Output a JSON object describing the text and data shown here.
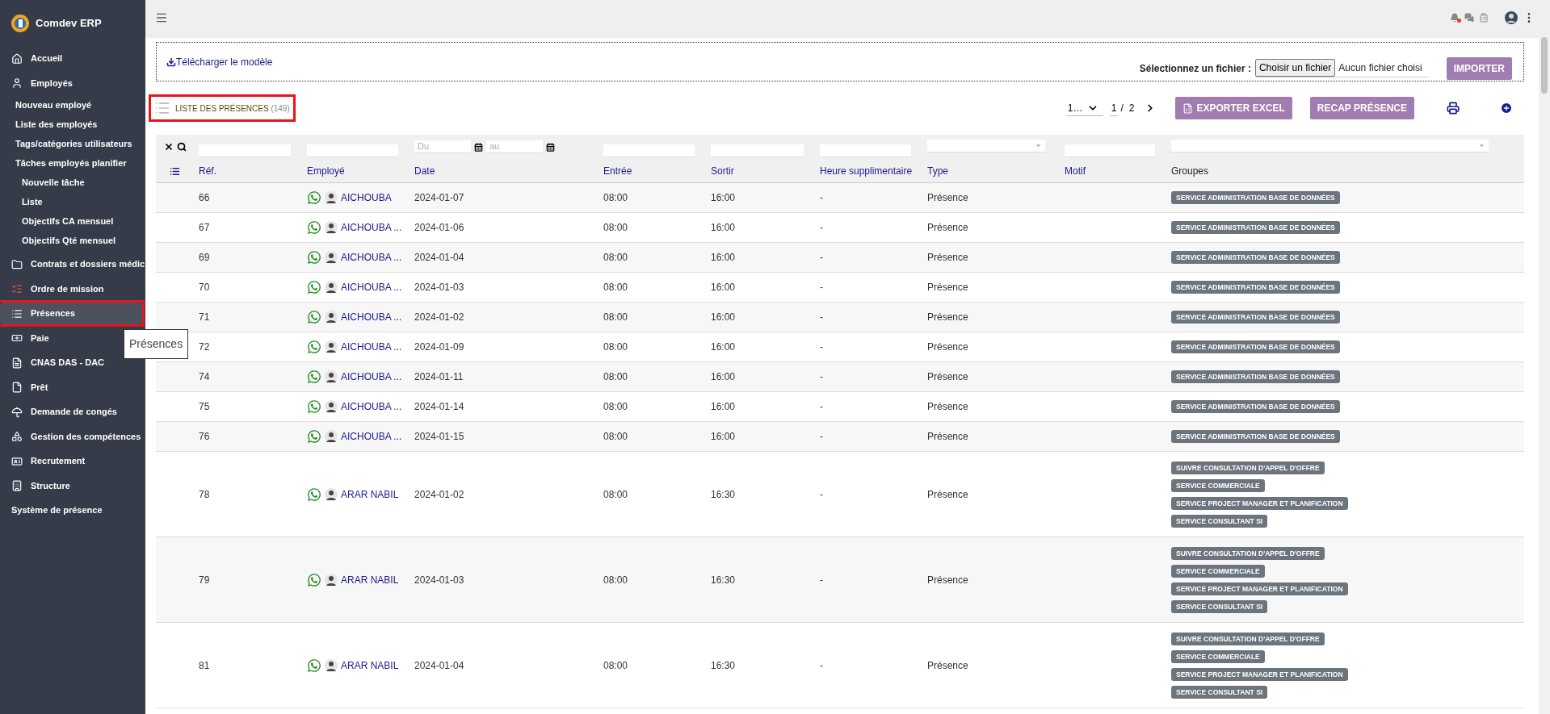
{
  "app": {
    "name": "Comdev ERP"
  },
  "sidebar": {
    "items": [
      {
        "label": "Accueil",
        "selected": false
      },
      {
        "label": "Employés",
        "selected": false,
        "children": [
          {
            "label": "Nouveau employé",
            "selected": false
          },
          {
            "label": "Liste des employés",
            "selected": false
          },
          {
            "label": "Tags/catégories utilisateurs",
            "selected": false
          },
          {
            "label": "Tâches employés planifier",
            "selected": false,
            "children": [
              {
                "label": "Nouvelle tâche",
                "selected": false
              },
              {
                "label": "Liste",
                "selected": false
              },
              {
                "label": "Objectifs CA mensuel",
                "selected": false
              },
              {
                "label": "Objectifs Qté mensuel",
                "selected": false
              }
            ]
          }
        ]
      },
      {
        "label": "Contrats et dossiers médic",
        "selected": false
      },
      {
        "label": "Ordre de mission",
        "selected": false
      },
      {
        "label": "Présences",
        "selected": true
      },
      {
        "label": "Paie",
        "selected": false
      },
      {
        "label": "CNAS DAS - DAC",
        "selected": false
      },
      {
        "label": "Prêt",
        "selected": false
      },
      {
        "label": "Demande de congés",
        "selected": false
      },
      {
        "label": "Gestion des compétences",
        "selected": false
      },
      {
        "label": "Recrutement",
        "selected": false
      },
      {
        "label": "Structure",
        "selected": false
      },
      {
        "label": "Système de présence",
        "selected": false
      }
    ],
    "tooltip": "Présences"
  },
  "upload": {
    "download_link": "Télécharger le modèle",
    "file_label": "Sélectionnez un fichier :",
    "file_button": "Choisir un fichier",
    "file_status": "Aucun fichier choisi",
    "import_button": "IMPORTER"
  },
  "list": {
    "title": "LISTE DES PRÉSENCES",
    "count": "(149)",
    "page_size": "1…",
    "page": "1",
    "page_sep": "/",
    "page_total": "2",
    "export_button": "EXPORTER EXCEL",
    "recap_button": "RECAP PRÉSENCE"
  },
  "filters": {
    "date_from_placeholder": "Du",
    "date_to_placeholder": "au"
  },
  "table": {
    "columns": [
      "Réf.",
      "Employé",
      "Date",
      "Entrée",
      "Sortir",
      "Heure supplimentaire",
      "Type",
      "Motif",
      "Groupes"
    ],
    "rows": [
      {
        "ref": "66",
        "employee": "AICHOUBA",
        "date": "2024-01-07",
        "entree": "08:00",
        "sortir": "16:00",
        "heure_sup": "-",
        "type": "Présence",
        "groups": [
          "SERVICE ADMINISTRATION BASE DE DONNÉES"
        ]
      },
      {
        "ref": "67",
        "employee": "AICHOUBA ...",
        "date": "2024-01-06",
        "entree": "08:00",
        "sortir": "16:00",
        "heure_sup": "-",
        "type": "Présence",
        "groups": [
          "SERVICE ADMINISTRATION BASE DE DONNÉES"
        ]
      },
      {
        "ref": "69",
        "employee": "AICHOUBA ...",
        "date": "2024-01-04",
        "entree": "08:00",
        "sortir": "16:00",
        "heure_sup": "-",
        "type": "Présence",
        "groups": [
          "SERVICE ADMINISTRATION BASE DE DONNÉES"
        ]
      },
      {
        "ref": "70",
        "employee": "AICHOUBA ...",
        "date": "2024-01-03",
        "entree": "08:00",
        "sortir": "16:00",
        "heure_sup": "-",
        "type": "Présence",
        "groups": [
          "SERVICE ADMINISTRATION BASE DE DONNÉES"
        ]
      },
      {
        "ref": "71",
        "employee": "AICHOUBA ...",
        "date": "2024-01-02",
        "entree": "08:00",
        "sortir": "16:00",
        "heure_sup": "-",
        "type": "Présence",
        "groups": [
          "SERVICE ADMINISTRATION BASE DE DONNÉES"
        ]
      },
      {
        "ref": "72",
        "employee": "AICHOUBA ...",
        "date": "2024-01-09",
        "entree": "08:00",
        "sortir": "16:00",
        "heure_sup": "-",
        "type": "Présence",
        "groups": [
          "SERVICE ADMINISTRATION BASE DE DONNÉES"
        ]
      },
      {
        "ref": "74",
        "employee": "AICHOUBA ...",
        "date": "2024-01-11",
        "entree": "08:00",
        "sortir": "16:00",
        "heure_sup": "-",
        "type": "Présence",
        "groups": [
          "SERVICE ADMINISTRATION BASE DE DONNÉES"
        ]
      },
      {
        "ref": "75",
        "employee": "AICHOUBA ...",
        "date": "2024-01-14",
        "entree": "08:00",
        "sortir": "16:00",
        "heure_sup": "-",
        "type": "Présence",
        "groups": [
          "SERVICE ADMINISTRATION BASE DE DONNÉES"
        ]
      },
      {
        "ref": "76",
        "employee": "AICHOUBA ...",
        "date": "2024-01-15",
        "entree": "08:00",
        "sortir": "16:00",
        "heure_sup": "-",
        "type": "Présence",
        "groups": [
          "SERVICE ADMINISTRATION BASE DE DONNÉES"
        ]
      },
      {
        "ref": "78",
        "employee": "ARAR NABIL",
        "date": "2024-01-02",
        "entree": "08:00",
        "sortir": "16:30",
        "heure_sup": "-",
        "type": "Présence",
        "groups": [
          "SUIVRE CONSULTATION D'APPEL D'OFFRE",
          "SERVICE COMMERCIALE",
          "SERVICE PROJECT MANAGER ET PLANIFICATION",
          "SERVICE CONSULTANT SI"
        ]
      },
      {
        "ref": "79",
        "employee": "ARAR NABIL",
        "date": "2024-01-03",
        "entree": "08:00",
        "sortir": "16:30",
        "heure_sup": "-",
        "type": "Présence",
        "groups": [
          "SUIVRE CONSULTATION D'APPEL D'OFFRE",
          "SERVICE COMMERCIALE",
          "SERVICE PROJECT MANAGER ET PLANIFICATION",
          "SERVICE CONSULTANT SI"
        ]
      },
      {
        "ref": "81",
        "employee": "ARAR NABIL",
        "date": "2024-01-04",
        "entree": "08:00",
        "sortir": "16:30",
        "heure_sup": "-",
        "type": "Présence",
        "groups": [
          "SUIVRE CONSULTATION D'APPEL D'OFFRE",
          "SERVICE COMMERCIALE",
          "SERVICE PROJECT MANAGER ET PLANIFICATION",
          "SERVICE CONSULTANT SI"
        ]
      }
    ]
  }
}
